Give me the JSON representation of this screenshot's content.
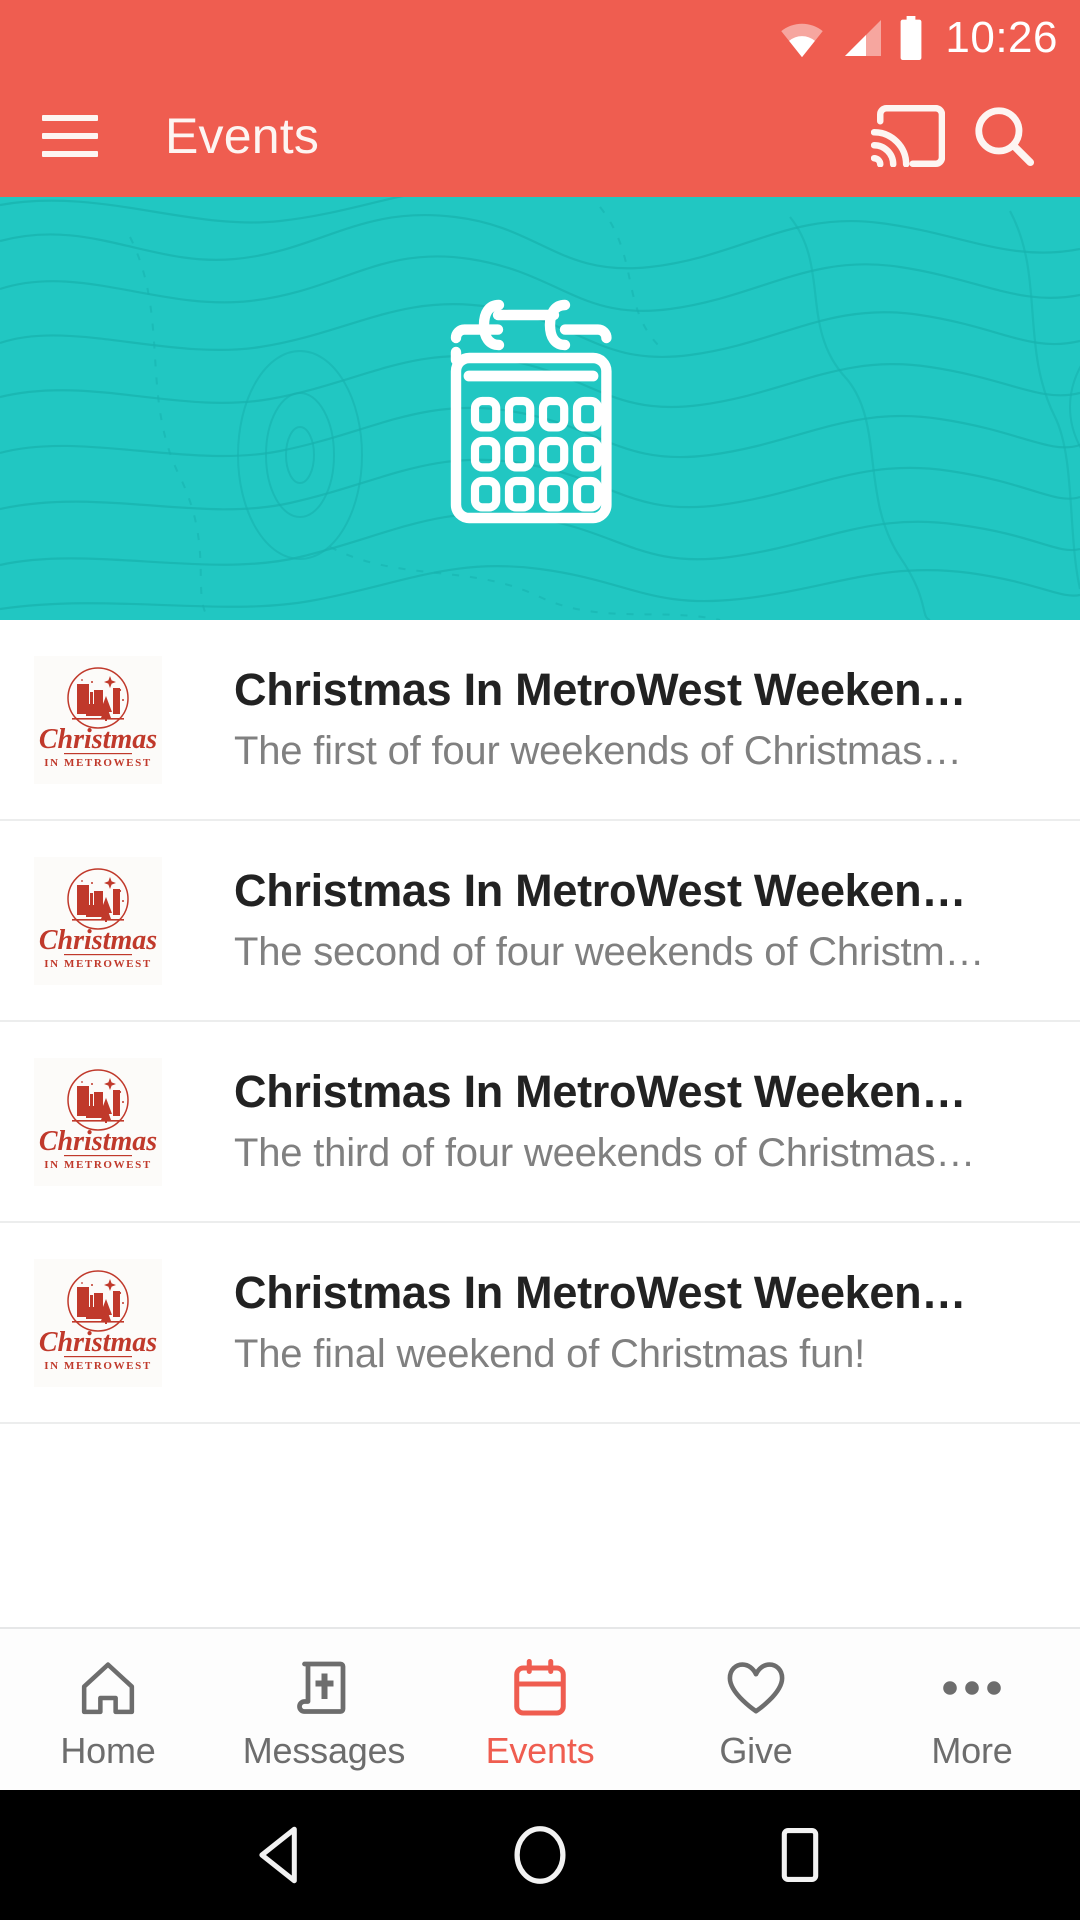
{
  "status_bar": {
    "time": "10:26",
    "icons": [
      "wifi-icon",
      "cellular-signal-icon",
      "battery-full-icon"
    ],
    "background_color": "#ef5d50",
    "foreground_color": "#ffffff"
  },
  "app_bar": {
    "menu_icon": "hamburger-menu-icon",
    "title": "Events",
    "cast_icon": "cast-icon",
    "search_icon": "search-icon",
    "background_color": "#ef5d50",
    "text_color": "#fdf5f2"
  },
  "hero": {
    "icon": "calendar-icon",
    "background_color": "#21c7c2",
    "pattern": "topographic-contour-lines",
    "icon_color": "#ffffff"
  },
  "events": [
    {
      "thumbnail": "christmas-in-metrowest-logo",
      "title": "Christmas In MetroWest Weeken…",
      "subtitle": "The first of four weekends of Christmas…"
    },
    {
      "thumbnail": "christmas-in-metrowest-logo",
      "title": "Christmas In MetroWest Weeken…",
      "subtitle": "The second of four weekends of Christm…"
    },
    {
      "thumbnail": "christmas-in-metrowest-logo",
      "title": "Christmas In MetroWest Weeken…",
      "subtitle": "The third of four weekends of Christmas…"
    },
    {
      "thumbnail": "christmas-in-metrowest-logo",
      "title": "Christmas In MetroWest Weeken…",
      "subtitle": "The final weekend of Christmas fun!"
    }
  ],
  "logo": {
    "script_text": "Christmas",
    "caption_text": "IN METROWEST",
    "color": "#c0392b"
  },
  "bottom_nav": {
    "items": [
      {
        "label": "Home",
        "icon": "home-icon",
        "active": false
      },
      {
        "label": "Messages",
        "icon": "bible-icon",
        "active": false
      },
      {
        "label": "Events",
        "icon": "calendar-icon",
        "active": true
      },
      {
        "label": "Give",
        "icon": "heart-icon",
        "active": false
      },
      {
        "label": "More",
        "icon": "more-dots-icon",
        "active": false
      }
    ],
    "active_color": "#ef5d50",
    "inactive_color": "#6d6d6d"
  },
  "system_nav": {
    "back": "back-triangle-icon",
    "home": "home-circle-icon",
    "recents": "recents-square-icon",
    "background_color": "#000000"
  }
}
